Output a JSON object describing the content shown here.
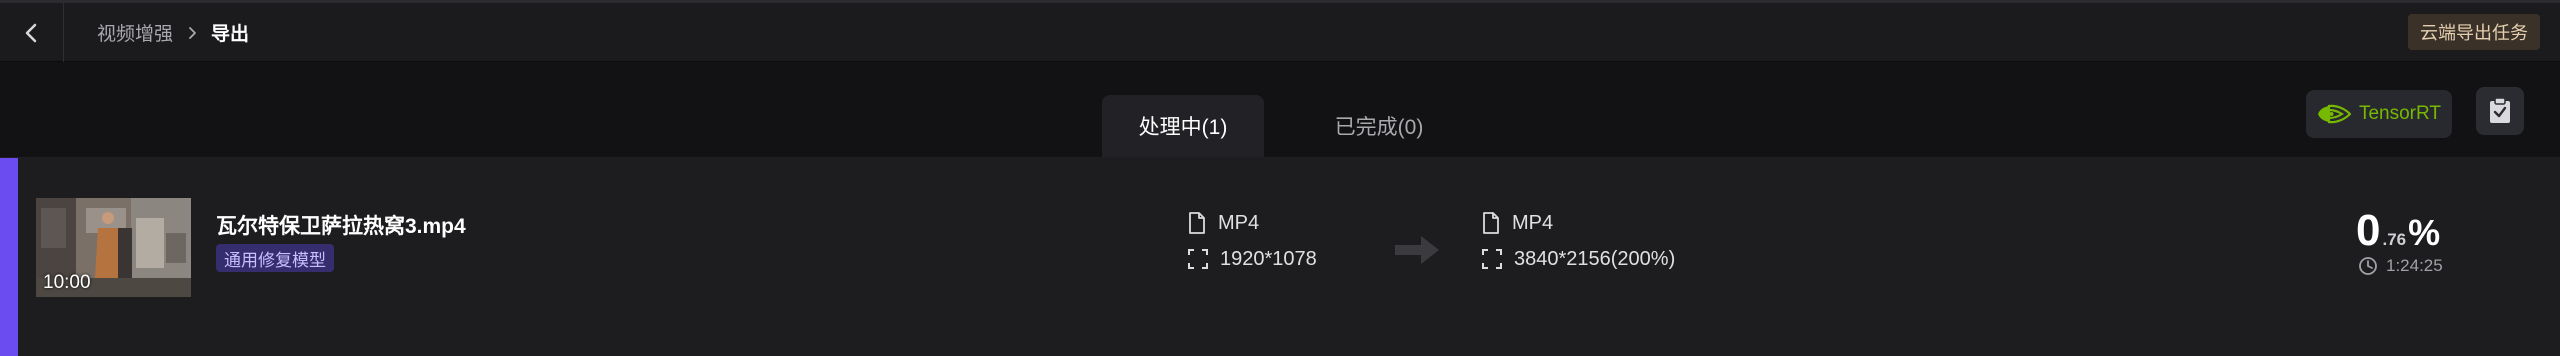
{
  "header": {
    "breadcrumb_root": "视频增强",
    "breadcrumb_current": "导出",
    "cloud_export_label": "云端导出任务"
  },
  "tabs": [
    {
      "label": "处理中(1)",
      "active": true
    },
    {
      "label": "已完成(0)",
      "active": false
    }
  ],
  "toolbar": {
    "tensorrt_label": "TensorRT",
    "tensorrt_icon": "nvidia-logo-icon",
    "clipboard_icon": "clipboard-check-icon"
  },
  "task": {
    "filename": "瓦尔特保卫萨拉热窝3.mp4",
    "duration": "10:00",
    "model_tag": "通用修复模型",
    "source": {
      "format": "MP4",
      "resolution": "1920*1078"
    },
    "output": {
      "format": "MP4",
      "resolution": "3840*2156(200%)"
    },
    "progress": {
      "int": "0",
      "decimal": ".76",
      "sign": "%"
    },
    "elapsed": "1:24:25"
  },
  "colors": {
    "accent": "#6b4cf0",
    "nvidia_green": "#76b900",
    "cloud_button_text": "#e5cfb0"
  }
}
